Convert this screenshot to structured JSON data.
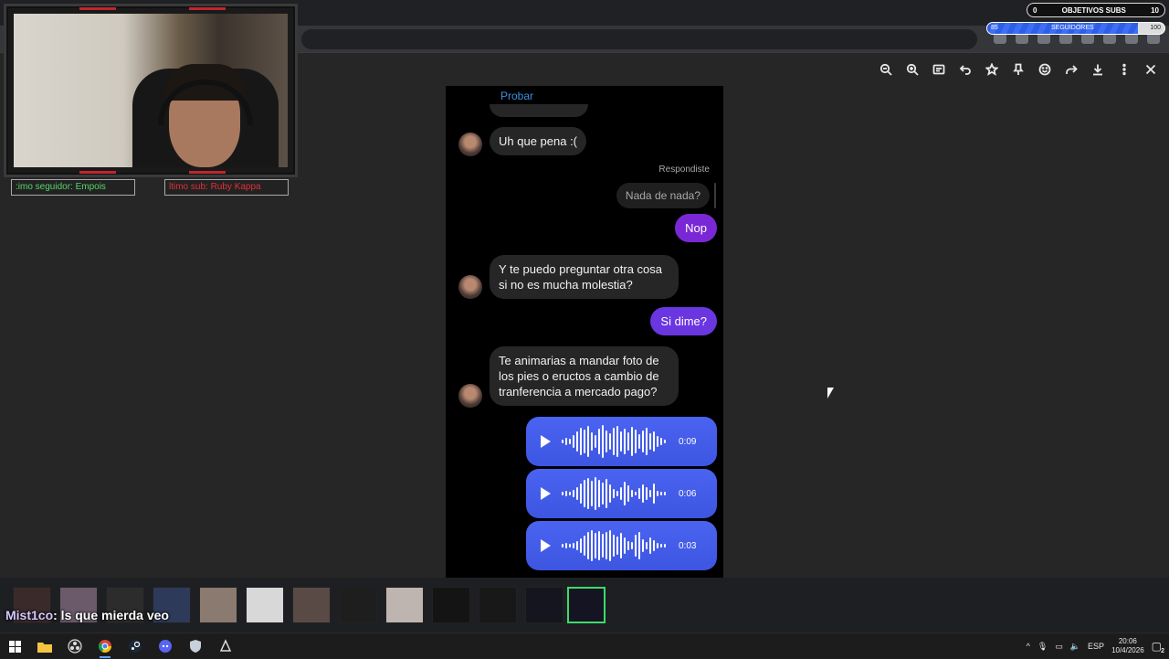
{
  "stream_overlay": {
    "follower_bar": ":imo seguidor: Empois",
    "subscriber_bar": "ltimo sub: Ruby Kappa",
    "goal_subs": {
      "label": "OBJETIVOS SUBS",
      "current": "0",
      "target": "10"
    },
    "goal_followers": {
      "label": "SEGUIDORES",
      "current": "85",
      "target": "100",
      "progress": 0.85
    },
    "chat_message": {
      "user": "Mist1co",
      "text": ": ls que mierda veo"
    }
  },
  "viewer_toolbar": {
    "buttons": [
      "zoom-out-icon",
      "zoom-in-icon",
      "caption-icon",
      "undo-icon",
      "star-icon",
      "pin-icon",
      "emoji-icon",
      "share-icon",
      "download-icon",
      "more-icon",
      "close-icon"
    ]
  },
  "chat": {
    "top_link": "Probar",
    "messages": [
      {
        "side": "in",
        "text": "Uh que pena :("
      },
      {
        "side": "reply_tag",
        "text": "Respondiste"
      },
      {
        "side": "reply_quote",
        "text": "Nada de nada?"
      },
      {
        "side": "out",
        "text": "Nop"
      },
      {
        "side": "in",
        "text": "Y te puedo preguntar otra cosa si no es mucha molestia?"
      },
      {
        "side": "out",
        "text": "Si dime?"
      },
      {
        "side": "in",
        "text": "Te animarias a mandar foto de los pies o eructos a cambio de tranferencia a mercado pago?"
      }
    ],
    "voice_notes": [
      {
        "duration": "0:09"
      },
      {
        "duration": "0:06"
      },
      {
        "duration": "0:03"
      }
    ]
  },
  "taskbar": {
    "apps": [
      "windows-start-icon",
      "file-explorer-icon",
      "obs-icon",
      "chrome-icon",
      "steam-icon",
      "discord-icon",
      "security-icon",
      "app-icon"
    ],
    "tray": {
      "language": "ESP",
      "time": "20:06",
      "date": "10/4/2026",
      "notifications": "2"
    }
  },
  "colors": {
    "outgoing_purple": "#7a28d6",
    "outgoing_violet": "#6a36e0",
    "voice_blue": "#4a63f0",
    "incoming_gray": "#262626",
    "link_blue": "#3d8fe0"
  }
}
